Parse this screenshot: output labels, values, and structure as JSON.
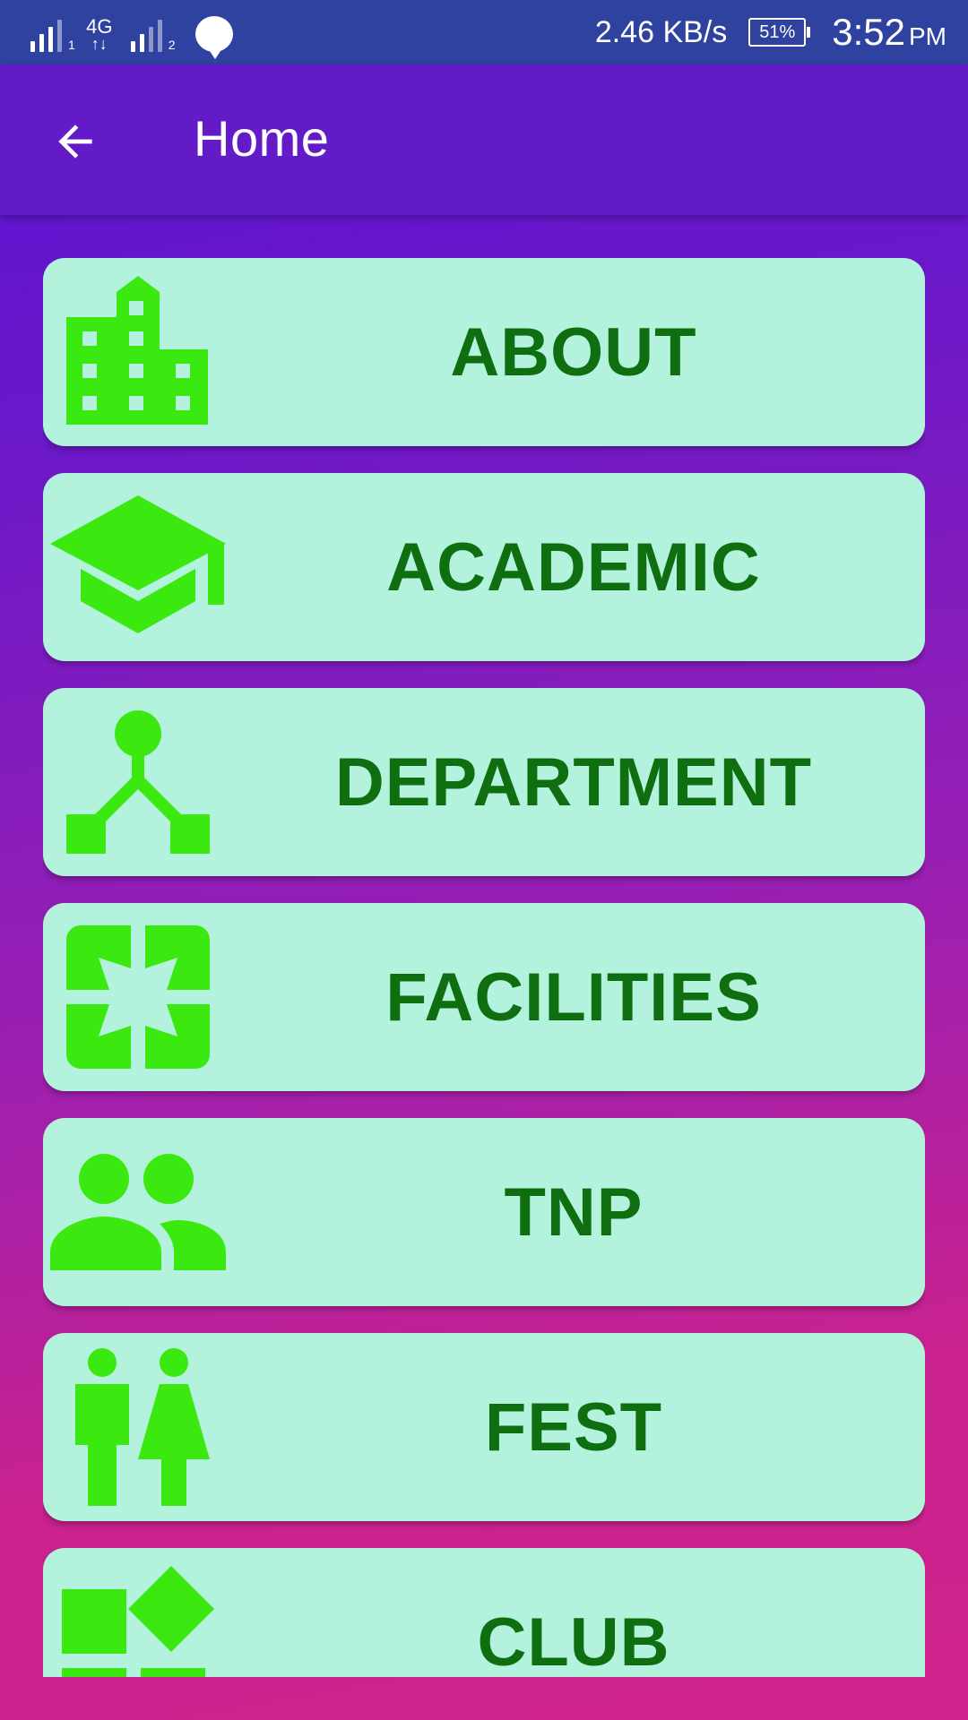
{
  "status_bar": {
    "network_type": "4G",
    "sim1_label": "1",
    "sim2_label": "2",
    "speed": "2.46 KB/s",
    "battery": "51%",
    "time": "3:52",
    "ampm": "PM"
  },
  "app_bar": {
    "title": "Home"
  },
  "menu": [
    {
      "label": "ABOUT",
      "icon": "building-icon"
    },
    {
      "label": "ACADEMIC",
      "icon": "graduation-cap-icon"
    },
    {
      "label": "DEPARTMENT",
      "icon": "hierarchy-icon"
    },
    {
      "label": "FACILITIES",
      "icon": "fullscreen-icon"
    },
    {
      "label": "TNP",
      "icon": "people-icon"
    },
    {
      "label": "FEST",
      "icon": "man-woman-icon"
    },
    {
      "label": "CLUB",
      "icon": "category-shapes-icon"
    }
  ],
  "colors": {
    "status_bar": "#2f42a0",
    "app_bar": "#631bc7",
    "card": "#b3f2dc",
    "icon": "#3be810",
    "label": "#0f6e10"
  }
}
